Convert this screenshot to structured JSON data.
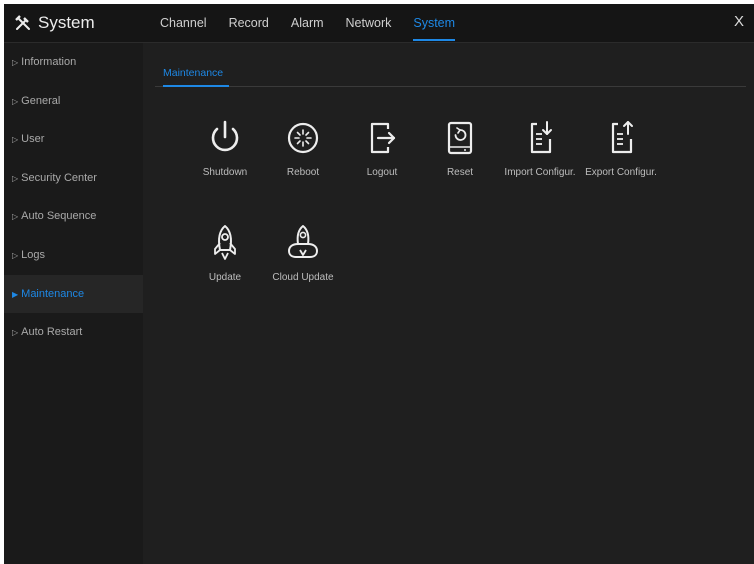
{
  "header": {
    "app_title": "System",
    "tabs": [
      "Channel",
      "Record",
      "Alarm",
      "Network",
      "System"
    ],
    "active_tab": "System",
    "close_glyph": "X"
  },
  "sidebar": {
    "items": [
      {
        "label": "Information"
      },
      {
        "label": "General"
      },
      {
        "label": "User"
      },
      {
        "label": "Security Center"
      },
      {
        "label": "Auto Sequence"
      },
      {
        "label": "Logs"
      },
      {
        "label": "Maintenance",
        "active": true
      },
      {
        "label": "Auto Restart"
      }
    ]
  },
  "main": {
    "section_title": "Maintenance",
    "tiles": [
      {
        "label": "Shutdown",
        "icon": "power-icon"
      },
      {
        "label": "Reboot",
        "icon": "reboot-icon"
      },
      {
        "label": "Logout",
        "icon": "logout-icon"
      },
      {
        "label": "Reset",
        "icon": "reset-icon"
      },
      {
        "label": "Import Configur.",
        "icon": "import-config-icon"
      },
      {
        "label": "Export Configur.",
        "icon": "export-config-icon"
      },
      {
        "label": "Update",
        "icon": "rocket-icon"
      },
      {
        "label": "Cloud Update",
        "icon": "cloud-rocket-icon"
      }
    ]
  },
  "colors": {
    "accent": "#1e88e5",
    "background": "#1f1f1f",
    "sidebar": "#1a1a1a",
    "topbar": "#151515",
    "text": "#bdbdbd"
  }
}
